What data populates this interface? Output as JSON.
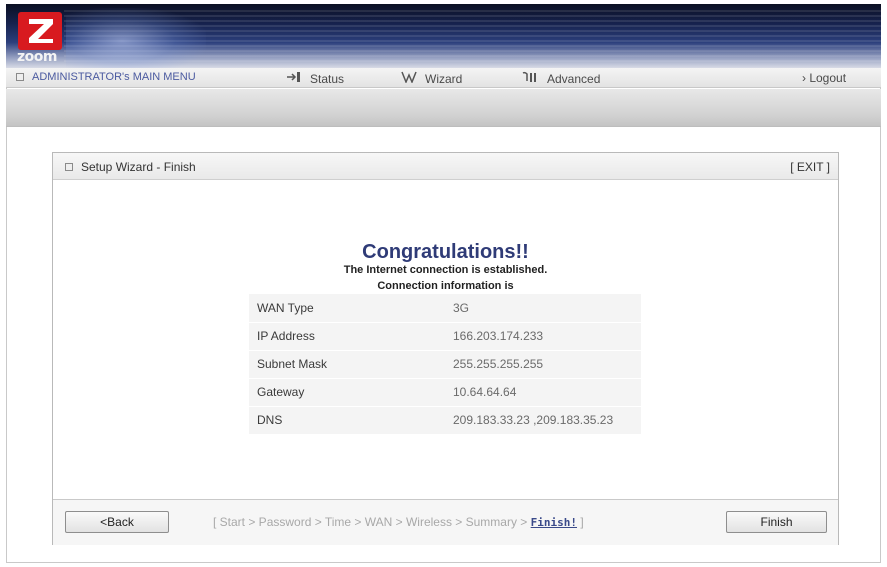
{
  "brand": {
    "logo_text": "zoom"
  },
  "menu": {
    "admin_label": "ADMINISTRATOR's MAIN MENU",
    "items": [
      {
        "label": "Status",
        "icon": "status-icon"
      },
      {
        "label": "Wizard",
        "icon": "wizard-icon"
      },
      {
        "label": "Advanced",
        "icon": "advanced-icon"
      }
    ],
    "logout_label": "› Logout"
  },
  "wizard": {
    "title": "Setup Wizard - Finish",
    "exit_label": "[ EXIT ]",
    "heading": "Congratulations!!",
    "line1": "The Internet connection is established.",
    "line2": "Connection information is",
    "rows": [
      {
        "label": "WAN Type",
        "value": "3G"
      },
      {
        "label": "IP Address",
        "value": "166.203.174.233"
      },
      {
        "label": "Subnet Mask",
        "value": "255.255.255.255"
      },
      {
        "label": "Gateway",
        "value": "10.64.64.64"
      },
      {
        "label": "DNS",
        "value": "209.183.33.23 ,209.183.35.23"
      }
    ],
    "back_label": "<Back",
    "finish_label": "Finish",
    "steps_prefix": "[ Start > Password > Time > WAN > Wireless > Summary > ",
    "steps_current": "Finish!",
    "steps_suffix": " ]"
  },
  "colors": {
    "accent": "#2f3b77",
    "logo_red": "#d81a1f",
    "header_dark": "#16224d"
  }
}
